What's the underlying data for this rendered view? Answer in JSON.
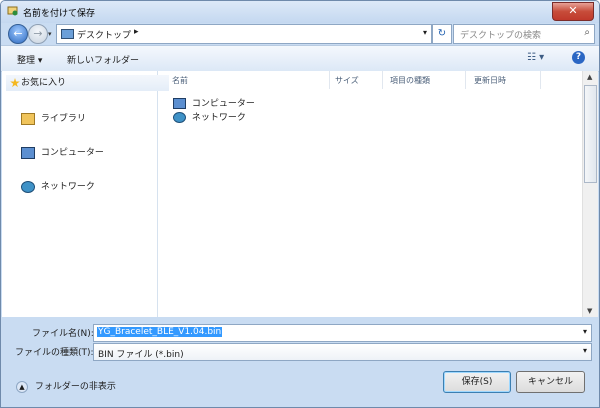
{
  "window": {
    "title": "名前を付けて保存",
    "close_icon": "x-close-icon"
  },
  "navigation": {
    "back_icon": "back-arrow-icon",
    "forward_icon": "forward-arrow-icon",
    "address": "デスクトップ",
    "refresh_icon": "refresh-icon",
    "search_placeholder": "デスクトップの検索",
    "search_icon": "magnifier-icon"
  },
  "toolbar": {
    "organize_label": "整理 ▾",
    "new_folder_label": "新しいフォルダー",
    "view_icon": "view-options-icon",
    "help_icon": "help-icon"
  },
  "sidebar": {
    "items": [
      {
        "label": "お気に入り",
        "icon": "star-icon"
      },
      {
        "label": "ライブラリ",
        "icon": "library-folder-icon"
      },
      {
        "label": "コンピューター",
        "icon": "computer-icon"
      },
      {
        "label": "ネットワーク",
        "icon": "network-icon"
      }
    ]
  },
  "files": {
    "columns": [
      "名前",
      "サイズ",
      "項目の種類",
      "更新日時"
    ],
    "rows": [
      {
        "name": "コンピューター",
        "icon": "computer-icon"
      },
      {
        "name": "ネットワーク",
        "icon": "network-icon"
      }
    ]
  },
  "form": {
    "filename_label": "ファイル名(N):",
    "filename_value": "YG_Bracelet_BLE_V1.04.bin",
    "filetype_label": "ファイルの種類(T):",
    "filetype_value": "BIN ファイル (*.bin)"
  },
  "footer": {
    "hide_folder_label": "フォルダーの非表示",
    "save_label": "保存(S)",
    "cancel_label": "キャンセル"
  }
}
